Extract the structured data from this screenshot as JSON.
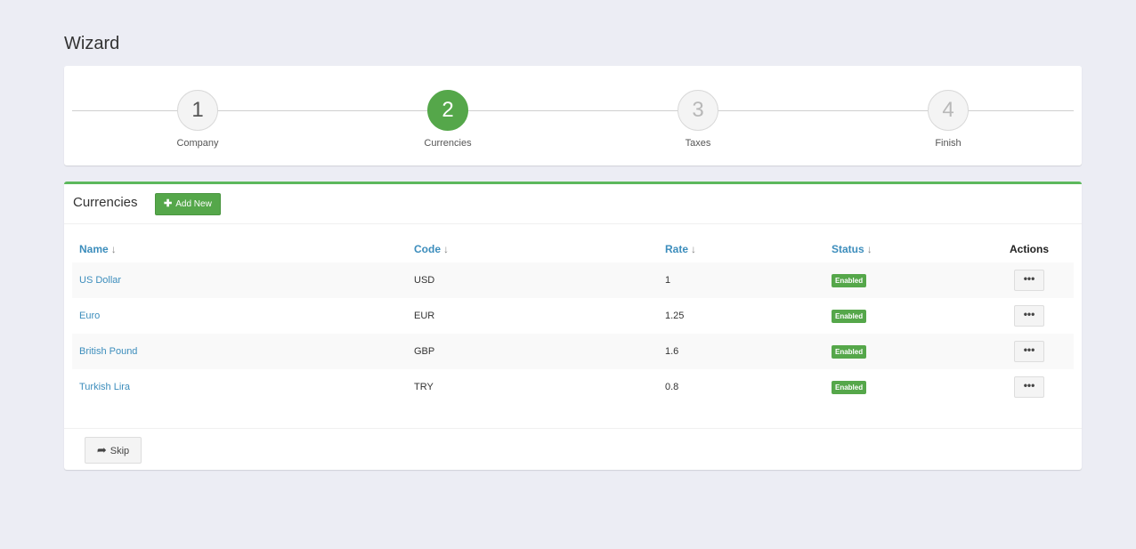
{
  "page": {
    "title": "Wizard"
  },
  "steps": [
    {
      "number": "1",
      "label": "Company",
      "state": "done"
    },
    {
      "number": "2",
      "label": "Currencies",
      "state": "active"
    },
    {
      "number": "3",
      "label": "Taxes",
      "state": "future"
    },
    {
      "number": "4",
      "label": "Finish",
      "state": "future"
    }
  ],
  "currencies": {
    "title": "Currencies",
    "add_new_label": "Add New",
    "columns": {
      "name": "Name",
      "code": "Code",
      "rate": "Rate",
      "status": "Status",
      "actions": "Actions"
    },
    "rows": [
      {
        "name": "US Dollar",
        "code": "USD",
        "rate": "1",
        "status": "Enabled"
      },
      {
        "name": "Euro",
        "code": "EUR",
        "rate": "1.25",
        "status": "Enabled"
      },
      {
        "name": "British Pound",
        "code": "GBP",
        "rate": "1.6",
        "status": "Enabled"
      },
      {
        "name": "Turkish Lira",
        "code": "TRY",
        "rate": "0.8",
        "status": "Enabled"
      }
    ],
    "skip_label": "Skip"
  },
  "colors": {
    "accent": "#55a74a",
    "link": "#3c8dbc",
    "background": "#ecedf4"
  }
}
